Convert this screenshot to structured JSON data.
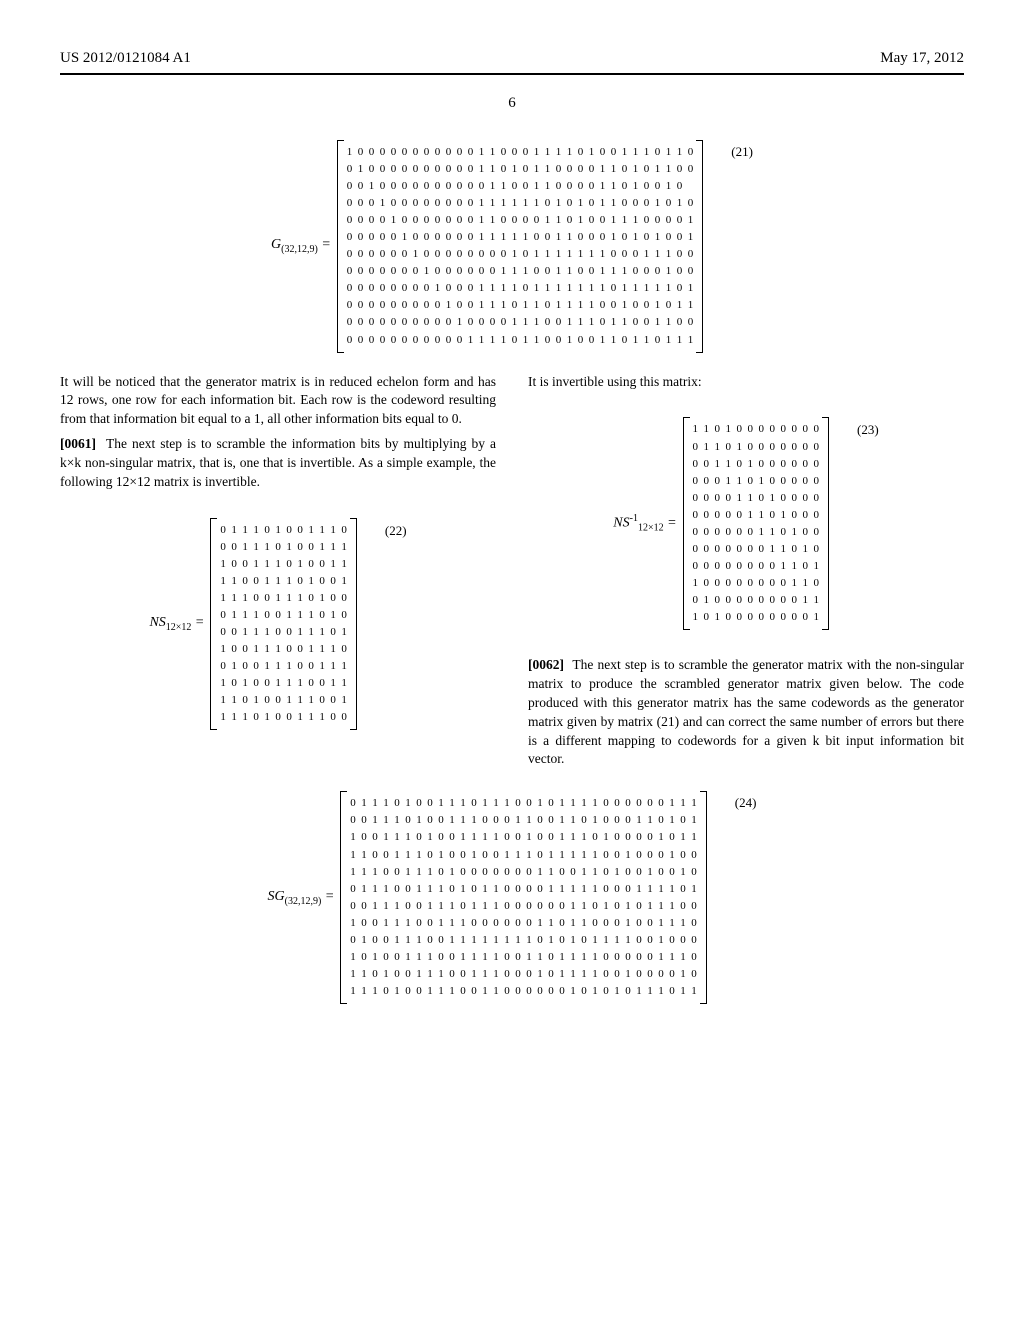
{
  "header": {
    "left": "US 2012/0121084 A1",
    "right": "May 17, 2012"
  },
  "page_number": "6",
  "matrix21": {
    "label_html": "G<sub>(32,12,9)</sub> =",
    "eq_num": "(21)",
    "rows": [
      "1 0 0 0 0 0 0 0 0 0 0 0 1 1 0 0 0 1 1 1 1 0 1 0 0 1 1 1 0 1 1 0",
      "0 1 0 0 0 0 0 0 0 0 0 0 1 1 0 1 0 1 1 0 0 0 0 1 1 0 1 0 1 1 0 0",
      "0 0 1 0 0 0 0 0 0 0 0 0 0 1 1 0 0 1 1 0 0 0 0 1 1 0 1 0 0 1 0",
      "0 0 0 1 0 0 0 0 0 0 0 0 1 1 1 1 1 1 0 1 0 1 0 1 1 0 0 0 1 0 1 0",
      "0 0 0 0 1 0 0 0 0 0 0 0 1 1 0 0 0 0 1 1 0 1 0 0 1 1 1 0 0 0 0 1",
      "0 0 0 0 0 1 0 0 0 0 0 0 1 1 1 1 1 0 0 1 1 0 0 0 1 0 1 0 1 0 0 1",
      "0 0 0 0 0 0 1 0 0 0 0 0 0 0 0 1 0 1 1 1 1 1 1 1 0 0 0 1 1 1 0 0",
      "0 0 0 0 0 0 0 1 0 0 0 0 0 0 1 1 1 0 0 1 1 0 0 1 1 1 0 0 0 1 0 0",
      "0 0 0 0 0 0 0 0 1 0 0 0 1 1 1 1 0 1 1 1 1 1 1 1 0 1 1 1 1 1 0 1",
      "0 0 0 0 0 0 0 0 0 1 0 0 1 1 1 0 1 1 0 1 1 1 1 0 0 1 0 0 1 0 1 1",
      "0 0 0 0 0 0 0 0 0 0 1 0 0 0 0 1 1 1 0 0 1 1 1 0 1 1 0 0 1 1 0 0",
      "0 0 0 0 0 0 0 0 0 0 0 1 1 1 1 0 1 1 0 0 1 0 0 1 1 0 1 1 0 1 1 1"
    ]
  },
  "left_col": {
    "p1": "It will be noticed that the generator matrix is in reduced echelon form and has 12 rows, one row for each information bit. Each row is the codeword resulting from that information bit equal to a 1, all other information bits equal to 0.",
    "p2_num": "[0061]",
    "p2": "The next step is to scramble the information bits by multiplying by a k×k non-singular matrix, that is, one that is invertible. As a simple example, the following 12×12 matrix is invertible."
  },
  "matrix22": {
    "label_html": "NS<sub>12×12</sub> =",
    "eq_num": "(22)",
    "rows": [
      "0 1 1 1 0 1 0 0 1 1 1 0",
      "0 0 1 1 1 0 1 0 0 1 1 1",
      "1 0 0 1 1 1 0 1 0 0 1 1",
      "1 1 0 0 1 1 1 0 1 0 0 1",
      "1 1 1 0 0 1 1 1 0 1 0 0",
      "0 1 1 1 0 0 1 1 1 0 1 0",
      "0 0 1 1 1 0 0 1 1 1 0 1",
      "1 0 0 1 1 1 0 0 1 1 1 0",
      "0 1 0 0 1 1 1 0 0 1 1 1",
      "1 0 1 0 0 1 1 1 0 0 1 1",
      "1 1 0 1 0 0 1 1 1 0 0 1",
      "1 1 1 0 1 0 0 1 1 1 0 0"
    ]
  },
  "right_col": {
    "p1": "It is invertible using this matrix:",
    "p2_num": "[0062]",
    "p2": "The next step is to scramble the generator matrix with the non-singular matrix to produce the scrambled generator matrix given below. The code produced with this generator matrix has the same codewords as the generator matrix given by matrix (21) and can correct the same number of errors but there is a different mapping to codewords for a given k bit input information bit vector."
  },
  "matrix23": {
    "label_html": "NS<sup>-1</sup><sub>12×12</sub> =",
    "eq_num": "(23)",
    "rows": [
      "1 1 0 1 0 0 0 0 0 0 0 0",
      "0 1 1 0 1 0 0 0 0 0 0 0",
      "0 0 1 1 0 1 0 0 0 0 0 0",
      "0 0 0 1 1 0 1 0 0 0 0 0",
      "0 0 0 0 1 1 0 1 0 0 0 0",
      "0 0 0 0 0 1 1 0 1 0 0 0",
      "0 0 0 0 0 0 1 1 0 1 0 0",
      "0 0 0 0 0 0 0 1 1 0 1 0",
      "0 0 0 0 0 0 0 0 1 1 0 1",
      "1 0 0 0 0 0 0 0 0 1 1 0",
      "0 1 0 0 0 0 0 0 0 0 1 1",
      "1 0 1 0 0 0 0 0 0 0 0 1"
    ]
  },
  "matrix24": {
    "label_html": "SG<sub>(32,12,9)</sub> =",
    "eq_num": "(24)",
    "rows": [
      "0 1 1 1 0 1 0 0 1 1 1 0 1 1 1 0 0 1 0 1 1 1 1 0 0 0 0 0 0 1 1 1",
      "0 0 1 1 1 0 1 0 0 1 1 1 0 0 0 1 1 0 0 1 1 0 1 0 0 0 1 1 0 1 0 1",
      "1 0 0 1 1 1 0 1 0 0 1 1 1 1 0 0 1 0 0 1 1 1 0 1 0 0 0 0 1 0 1 1",
      "1 1 0 0 1 1 1 0 1 0 0 1 0 0 1 1 1 0 1 1 1 1 1 0 0 1 0 0 0 1 0 0",
      "1 1 1 0 0 1 1 1 0 1 0 0 0 0 0 0 0 1 1 0 0 1 1 0 1 0 0 1 0 0 1 0",
      "0 1 1 1 0 0 1 1 1 0 1 0 1 1 0 0 0 0 1 1 1 1 1 0 0 0 1 1 1 1 0 1",
      "0 0 1 1 1 0 0 1 1 1 0 1 1 1 0 0 0 0 0 0 1 1 0 1 0 1 0 1 1 1 0 0",
      "1 0 0 1 1 1 0 0 1 1 1 0 0 0 0 0 0 1 1 0 1 1 0 0 0 1 0 0 1 1 1 0",
      "0 1 0 0 1 1 1 0 0 1 1 1 1 1 1 1 1 0 1 0 1 0 1 1 1 1 0 0 1 0 0 0",
      "1 0 1 0 0 1 1 1 0 0 1 1 1 1 0 0 1 1 0 1 1 1 1 0 0 0 0 0 1 1 1 0",
      "1 1 0 1 0 0 1 1 1 0 0 1 1 1 0 0 0 1 0 1 1 1 1 0 0 1 0 0 0 0 1 0",
      "1 1 1 0 1 0 0 1 1 1 0 0 1 1 0 0 0 0 0 0 1 0 1 0 1 0 1 1 1 0 1 1"
    ]
  }
}
